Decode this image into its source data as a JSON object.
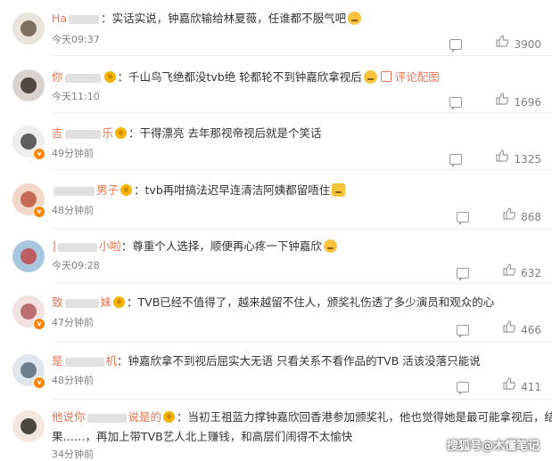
{
  "comments": [
    {
      "user_visible": "Ha",
      "text": "实话实说，钟嘉欣输给林夏薇，任谁都不服气吧",
      "time": "今天09:37",
      "likes": "3900"
    },
    {
      "user_visible": "你",
      "text": "千山鸟飞绝都没tvb绝 轮都轮不到钟嘉欣拿视后",
      "pic_label": "评论配图",
      "time": "今天11:10",
      "likes": "1696"
    },
    {
      "user_visible": "吉",
      "user_tail": "乐",
      "text": "干得漂亮 去年那视帝视后就是个笑话",
      "time": "49分钟前",
      "likes": "1325"
    },
    {
      "user_visible": "",
      "user_tail": "男子",
      "text": "tvb再咁搞法迟早连清洁阿姨都留唔住",
      "time": "48分钟前",
      "likes": "868"
    },
    {
      "user_visible": "]",
      "user_tail": "小啦",
      "text": "尊重个人选择，顺便再心疼一下钟嘉欣",
      "time": "今天09:28",
      "likes": "632"
    },
    {
      "user_visible": "致",
      "user_tail": "妹",
      "text": "TVB已经不值得了，越来越留不住人，颁奖礼伤透了多少演员和观众的心",
      "time": "47分钟前",
      "likes": "466"
    },
    {
      "user_visible": "是",
      "user_tail": "机",
      "text": "钟嘉欣拿不到视后屈实大无语 只看关系不看作品的TVB 活该没落只能说",
      "time": "48分钟前",
      "likes": "411"
    },
    {
      "user_visible": "他说你",
      "user_tail": "说是的",
      "text": "当初王祖蓝力撑钟嘉欣回香港参加颁奖礼，他也觉得她是最可能拿视后，结",
      "text2": "果……，再加上带TVB艺人北上赚钱，和高层们闹得不太愉快",
      "time": "34分钟前",
      "likes": ""
    }
  ],
  "watermark": "搜狐号@木懂笔记"
}
